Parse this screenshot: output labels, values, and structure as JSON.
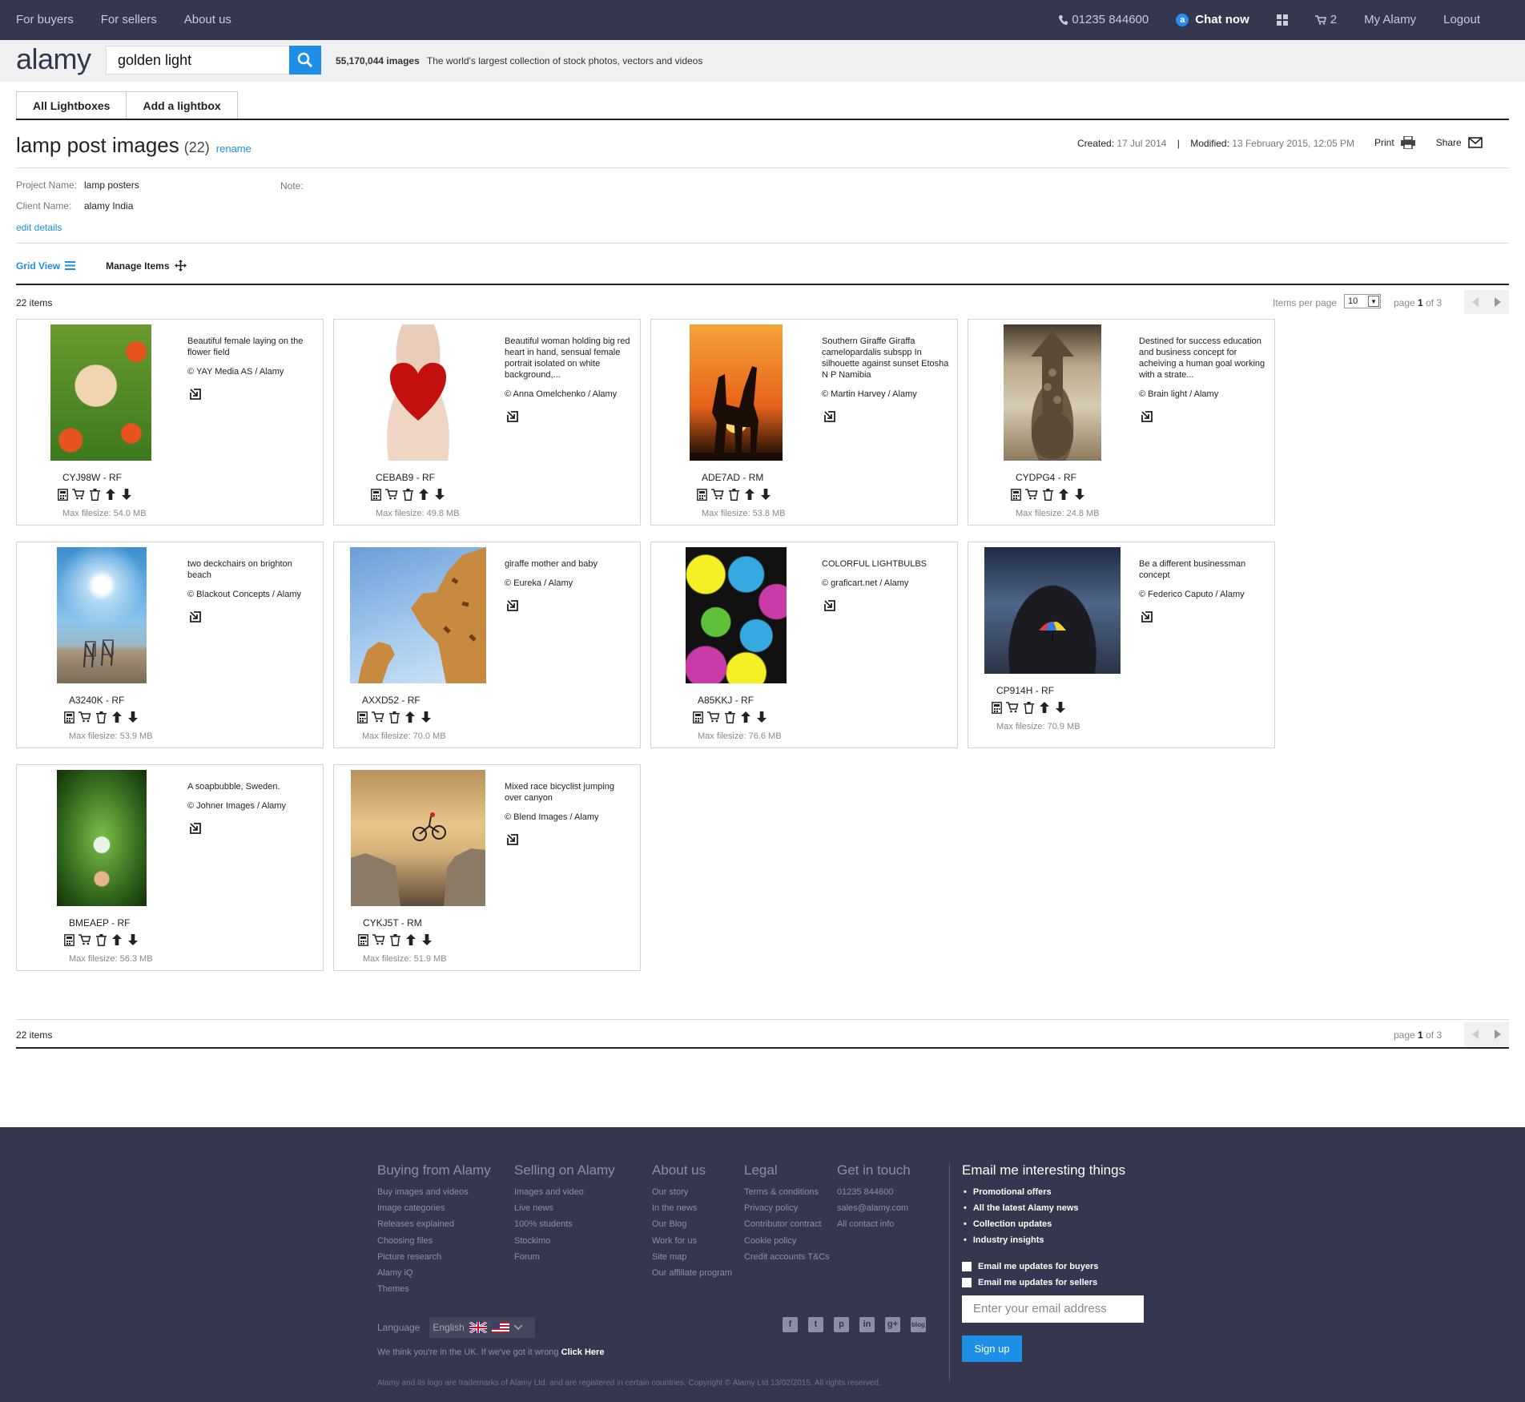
{
  "topnav": {
    "left": [
      "For buyers",
      "For sellers",
      "About us"
    ],
    "phone": "01235 844600",
    "chat": "Chat now",
    "cart_count": "2",
    "my_alamy": "My Alamy",
    "logout": "Logout"
  },
  "search": {
    "logo": "alamy",
    "query": "golden light",
    "count": "55,170,044 images",
    "tagline": "The world's largest collection of stock photos, vectors and videos"
  },
  "tabs": [
    "All Lightboxes",
    "Add a lightbox"
  ],
  "lightbox": {
    "title": "lamp post images",
    "count": "(22)",
    "rename": "rename",
    "created_label": "Created:",
    "created": "17 Jul 2014",
    "modified_label": "Modified:",
    "modified": "13 February 2015, 12:05 PM",
    "print": "Print",
    "share": "Share",
    "project_label": "Project Name:",
    "project": "lamp posters",
    "client_label": "Client Name:",
    "client": "alamy India",
    "note_label": "Note:",
    "edit": "edit details",
    "grid_view": "Grid View",
    "manage": "Manage Items"
  },
  "pagination": {
    "items": "22 items",
    "per_page_label": "Items per page",
    "per_page": "10",
    "page_label": "page",
    "page": "1",
    "of_label": "of",
    "total_pages": "3"
  },
  "cards": [
    {
      "desc": "Beautiful female laying on the flower field",
      "credit": "© YAY Media AS / Alamy",
      "code": "CYJ98W - RF",
      "size": "Max filesize: 54.0 MB"
    },
    {
      "desc": "Beautiful woman holding big red heart in hand, sensual female portrait isolated on white background,...",
      "credit": "© Anna Omelchenko / Alamy",
      "code": "CEBAB9 - RF",
      "size": "Max filesize: 49.8 MB"
    },
    {
      "desc": "Southern Giraffe Giraffa camelopardalis subspp In silhouette against sunset Etosha N P Namibia",
      "credit": "© Martin Harvey / Alamy",
      "code": "ADE7AD - RM",
      "size": "Max filesize: 53.8 MB"
    },
    {
      "desc": "Destined for success education and business concept for acheiving a human goal working with a strate...",
      "credit": "© Brain light / Alamy",
      "code": "CYDPG4 - RF",
      "size": "Max filesize: 24.8 MB"
    },
    {
      "desc": "two deckchairs on brighton beach",
      "credit": "© Blackout Concepts / Alamy",
      "code": "A3240K - RF",
      "size": "Max filesize: 53.9 MB"
    },
    {
      "desc": "giraffe mother and baby",
      "credit": "© Eureka / Alamy",
      "code": "AXXD52 - RF",
      "size": "Max filesize: 70.0 MB"
    },
    {
      "desc": "COLORFUL LIGHTBULBS",
      "credit": "© graficart.net / Alamy",
      "code": "A85KKJ - RF",
      "size": "Max filesize: 76.6 MB"
    },
    {
      "desc": "Be a different businessman concept",
      "credit": "© Federico Caputo / Alamy",
      "code": "CP914H - RF",
      "size": "Max filesize: 70.9 MB"
    },
    {
      "desc": "A soapbubble, Sweden.",
      "credit": "© Johner Images / Alamy",
      "code": "BMEAEP - RF",
      "size": "Max filesize: 56.3 MB"
    },
    {
      "desc": "Mixed race bicyclist jumping over canyon",
      "credit": "© Blend Images / Alamy",
      "code": "CYKJ5T - RM",
      "size": "Max filesize: 51.9 MB"
    }
  ],
  "footer": {
    "cols": [
      {
        "title": "Buying from Alamy",
        "links": [
          "Buy images and videos",
          "Image categories",
          "Releases explained",
          "Choosing files",
          "Picture research",
          "Alamy iQ",
          "Themes"
        ]
      },
      {
        "title": "Selling on Alamy",
        "links": [
          "Images and video",
          "Live news",
          "100% students",
          "Stockimo",
          "Forum"
        ]
      },
      {
        "title": "About us",
        "links": [
          "Our story",
          "In the news",
          "Our Blog",
          "Work for us",
          "Site map",
          "Our affiliate program"
        ]
      },
      {
        "title": "Legal",
        "links": [
          "Terms & conditions",
          "Privacy policy",
          "Contributor contract",
          "Cookie policy",
          "Credit accounts T&Cs"
        ]
      },
      {
        "title": "Get in touch",
        "links": [
          "01235 844600",
          "sales@alamy.com",
          "All contact info"
        ]
      }
    ],
    "email_title": "Email me interesting things",
    "bullets": [
      "Promotional offers",
      "All the latest Alamy news",
      "Collection updates",
      "Industry insights"
    ],
    "check_buyers": "Email me updates for buyers",
    "check_sellers": "Email me updates for sellers",
    "email_placeholder": "Enter your email address",
    "signup": "Sign up",
    "language_label": "Language",
    "language": "English",
    "geo_text": "We think you're in the UK. If we've got it wrong",
    "geo_link": "Click Here",
    "copyright": "Alamy and its logo are trademarks of Alamy Ltd. and are registered in certain countries. Copyright © Alamy Ltd 13/02/2015. All rights reserved."
  }
}
